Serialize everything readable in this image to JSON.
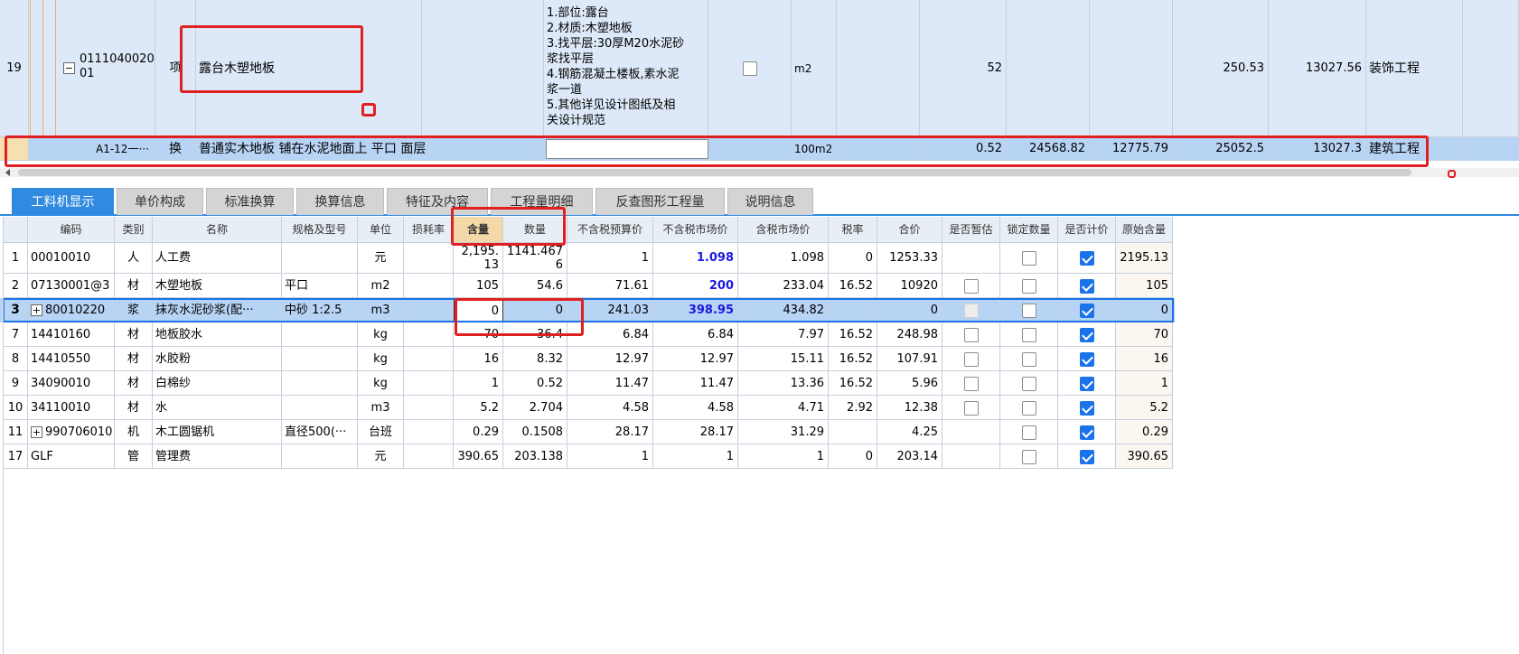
{
  "top": {
    "row19": {
      "num": "19",
      "code_line1": "0111040020",
      "code_line2": "01",
      "type": "项",
      "name": "露台木塑地板",
      "features": [
        "1.部位:露台",
        "2.材质:木塑地板",
        "3.找平层:30厚M20水泥砂",
        "浆找平层",
        "4.钢筋混凝土楼板,素水泥",
        "浆一道",
        "5.其他详见设计图纸及相",
        "关设计规范"
      ],
      "unit": "m2",
      "qty": "52",
      "price": "250.53",
      "total": "13027.56",
      "category": "装饰工程"
    },
    "sub": {
      "code": "A1-12一···",
      "type": "换",
      "name": "普通实木地板 铺在水泥地面上 平口 面层",
      "unit": "100m2",
      "v1": "0.52",
      "v2": "24568.82",
      "v3": "12775.79",
      "v4": "25052.5",
      "v5": "13027.3",
      "category": "建筑工程"
    }
  },
  "tabs": [
    "工料机显示",
    "单价构成",
    "标准换算",
    "换算信息",
    "特征及内容",
    "工程量明细",
    "反查图形工程量",
    "说明信息"
  ],
  "headers": [
    "编码",
    "类别",
    "名称",
    "规格及型号",
    "单位",
    "损耗率",
    "含量",
    "数量",
    "不含税预算价",
    "不含税市场价",
    "含税市场价",
    "税率",
    "合价",
    "是否暂估",
    "锁定数量",
    "是否计价",
    "原始含量"
  ],
  "rows": [
    {
      "no": "1",
      "code": "00010010",
      "cat": "人",
      "name": "人工费",
      "spec": "",
      "unit": "元",
      "loss": "",
      "content_a": "2,195.",
      "content_b": "13",
      "qty_a": "1141.467",
      "qty_b": "6",
      "budget": "1",
      "market": "1.098",
      "tax_market": "1.098",
      "rate": "0",
      "total": "1253.33",
      "est": "none",
      "lock": "off",
      "count": "on",
      "orig": "2195.13"
    },
    {
      "no": "2",
      "code": "07130001@3",
      "cat": "材",
      "name": "木塑地板",
      "spec": "平口",
      "unit": "m2",
      "loss": "",
      "content": "105",
      "qty": "54.6",
      "budget": "71.61",
      "market": "200",
      "tax_market": "233.04",
      "rate": "16.52",
      "total": "10920",
      "est": "off",
      "lock": "off",
      "count": "on",
      "orig": "105"
    },
    {
      "no": "3",
      "code": "80010220",
      "cat": "浆",
      "name": "抹灰水泥砂浆(配···",
      "spec": "中砂 1:2.5",
      "unit": "m3",
      "loss": "",
      "content": "0",
      "qty": "0",
      "budget": "241.03",
      "market": "398.95",
      "tax_market": "434.82",
      "rate": "",
      "total": "0",
      "est": "dis",
      "lock": "off",
      "count": "on",
      "orig": "0"
    },
    {
      "no": "7",
      "code": "14410160",
      "cat": "材",
      "name": "地板胶水",
      "spec": "",
      "unit": "kg",
      "loss": "",
      "content": "70",
      "qty": "36.4",
      "budget": "6.84",
      "market": "6.84",
      "tax_market": "7.97",
      "rate": "16.52",
      "total": "248.98",
      "est": "off",
      "lock": "off",
      "count": "on",
      "orig": "70"
    },
    {
      "no": "8",
      "code": "14410550",
      "cat": "材",
      "name": "水胶粉",
      "spec": "",
      "unit": "kg",
      "loss": "",
      "content": "16",
      "qty": "8.32",
      "budget": "12.97",
      "market": "12.97",
      "tax_market": "15.11",
      "rate": "16.52",
      "total": "107.91",
      "est": "off",
      "lock": "off",
      "count": "on",
      "orig": "16"
    },
    {
      "no": "9",
      "code": "34090010",
      "cat": "材",
      "name": "白棉纱",
      "spec": "",
      "unit": "kg",
      "loss": "",
      "content": "1",
      "qty": "0.52",
      "budget": "11.47",
      "market": "11.47",
      "tax_market": "13.36",
      "rate": "16.52",
      "total": "5.96",
      "est": "off",
      "lock": "off",
      "count": "on",
      "orig": "1"
    },
    {
      "no": "10",
      "code": "34110010",
      "cat": "材",
      "name": "水",
      "spec": "",
      "unit": "m3",
      "loss": "",
      "content": "5.2",
      "qty": "2.704",
      "budget": "4.58",
      "market": "4.58",
      "tax_market": "4.71",
      "rate": "2.92",
      "total": "12.38",
      "est": "off",
      "lock": "off",
      "count": "on",
      "orig": "5.2"
    },
    {
      "no": "11",
      "code": "990706010",
      "cat": "机",
      "name": "木工圆锯机",
      "spec": "直径500(···",
      "unit": "台班",
      "loss": "",
      "content": "0.29",
      "qty": "0.1508",
      "budget": "28.17",
      "market": "28.17",
      "tax_market": "31.29",
      "rate": "",
      "total": "4.25",
      "est": "none",
      "lock": "off",
      "count": "on",
      "orig": "0.29"
    },
    {
      "no": "17",
      "code": "GLF",
      "cat": "管",
      "name": "管理费",
      "spec": "",
      "unit": "元",
      "loss": "",
      "content": "390.65",
      "qty": "203.138",
      "budget": "1",
      "market": "1",
      "tax_market": "1",
      "rate": "0",
      "total": "203.14",
      "est": "none",
      "lock": "off",
      "count": "on",
      "orig": "390.65"
    }
  ],
  "colors": {
    "accent": "#2f8ae0",
    "highlight_row": "#b8d4f5",
    "top_bg": "#dde9f8",
    "red": "#e02020",
    "market_blue": "#1a1ae0"
  }
}
